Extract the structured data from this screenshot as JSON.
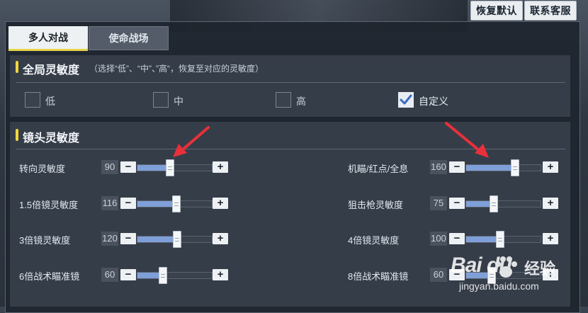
{
  "top_buttons": {
    "restore_default": "恢复默认",
    "contact_service": "联系客服"
  },
  "tabs": [
    {
      "label": "多人对战",
      "active": true
    },
    {
      "label": "使命战场",
      "active": false
    }
  ],
  "global_section": {
    "title": "全局灵敏度",
    "hint": "（选择“低”、“中”、”高“，恢复至对应的灵敏度）",
    "options": [
      {
        "label": "低",
        "checked": false
      },
      {
        "label": "中",
        "checked": false
      },
      {
        "label": "高",
        "checked": false
      },
      {
        "label": "自定义",
        "checked": true
      }
    ]
  },
  "camera_section": {
    "title": "镜头灵敏度",
    "rows_left": [
      {
        "label": "转向灵敏度",
        "value": "90",
        "fraction": 0.43
      },
      {
        "label": "1.5倍镜灵敏度",
        "value": "116",
        "fraction": 0.51
      },
      {
        "label": "3倍镜灵敏度",
        "value": "120",
        "fraction": 0.52
      },
      {
        "label": "6倍战术瞄准镜",
        "value": "60",
        "fraction": 0.33
      }
    ],
    "rows_right": [
      {
        "label": "机瞄/红点/全息",
        "value": "160",
        "fraction": 0.65
      },
      {
        "label": "狙击枪灵敏度",
        "value": "75",
        "fraction": 0.36
      },
      {
        "label": "4倍镜灵敏度",
        "value": "100",
        "fraction": 0.45
      },
      {
        "label": "8倍战术瞄准镜",
        "value": "60",
        "fraction": 0.33
      }
    ]
  },
  "stepper": {
    "minus": "−",
    "plus": "+"
  },
  "watermark": {
    "brand": "Bai du",
    "cn": "经验",
    "url": "jingyan.baidu.com"
  },
  "colors": {
    "accent_yellow": "#f1d73f",
    "slider_fill": "#7f9fd8",
    "arrow_red": "#e8303a"
  }
}
